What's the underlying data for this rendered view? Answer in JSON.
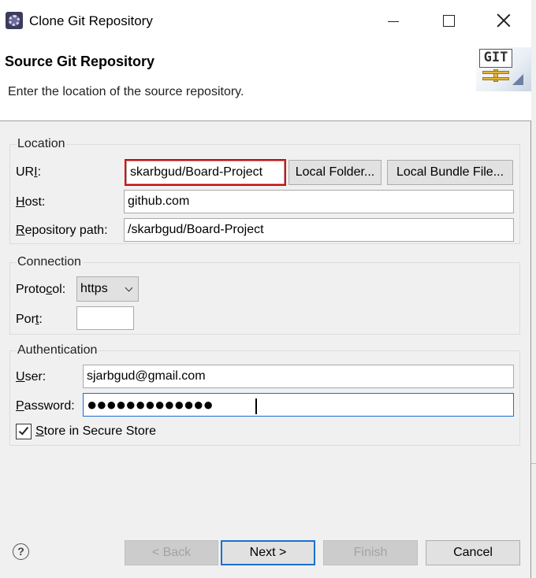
{
  "window": {
    "title": "Clone Git Repository",
    "controls": {
      "minimize": "minimize",
      "maximize": "maximize",
      "close": "close"
    }
  },
  "header": {
    "title": "Source Git Repository",
    "description": "Enter the location of the source repository.",
    "logo_text": "GIT"
  },
  "location": {
    "group_label": "Location",
    "uri_label": "URI:",
    "uri_value": "skarbgud/Board-Project",
    "local_folder_button": "Local Folder...",
    "local_bundle_button": "Local Bundle File...",
    "host_label": "Host:",
    "host_value": "github.com",
    "repo_path_label": "Repository path:",
    "repo_path_value": "/skarbgud/Board-Project"
  },
  "connection": {
    "group_label": "Connection",
    "protocol_label": "Protocol:",
    "protocol_value": "https",
    "port_label": "Port:",
    "port_value": ""
  },
  "authentication": {
    "group_label": "Authentication",
    "user_label": "User:",
    "user_value": "sjarbgud@gmail.com",
    "password_label": "Password:",
    "password_value": "●●●●●●●●●●●●●",
    "store_label": "Store in Secure Store",
    "store_checked": true
  },
  "footer": {
    "back_button": "< Back",
    "next_button": "Next >",
    "finish_button": "Finish",
    "cancel_button": "Cancel",
    "help_glyph": "?"
  },
  "colors": {
    "highlight": "#e00000",
    "focus": "#1a6fd1"
  }
}
